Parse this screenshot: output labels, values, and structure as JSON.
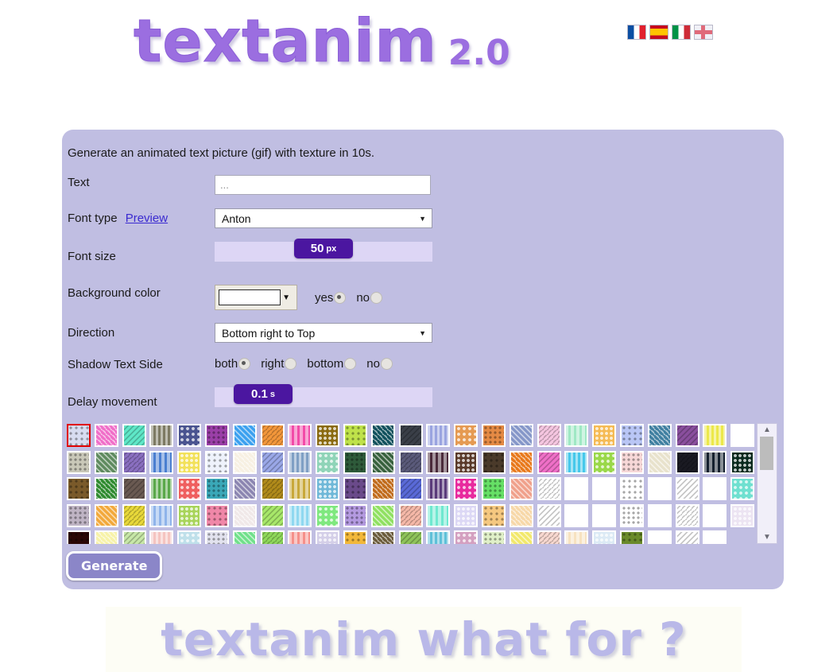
{
  "header": {
    "logo_word": "textanim",
    "logo_version": "2.0",
    "flags": [
      {
        "name": "flag-france",
        "label": "French"
      },
      {
        "name": "flag-spain",
        "label": "Spanish"
      },
      {
        "name": "flag-italy",
        "label": "Italian"
      },
      {
        "name": "flag-uk",
        "label": "English"
      }
    ]
  },
  "form": {
    "intro": "Generate an animated text picture (gif) with texture in 10s.",
    "text": {
      "label": "Text",
      "value": "",
      "placeholder": "..."
    },
    "font_type": {
      "label": "Font type",
      "preview_link": "Preview",
      "value": "Anton"
    },
    "font_size": {
      "label": "Font size",
      "value": "50",
      "unit": "px",
      "thumb_label": "50",
      "percent": 50
    },
    "background_color": {
      "label": "Background color",
      "swatch_color": "#ffffff",
      "options": [
        {
          "label": "yes",
          "selected": true
        },
        {
          "label": "no",
          "selected": false
        }
      ]
    },
    "direction": {
      "label": "Direction",
      "value": "Bottom right to Top"
    },
    "shadow_text_side": {
      "label": "Shadow Text Side",
      "options": [
        {
          "label": "both",
          "selected": true
        },
        {
          "label": "right",
          "selected": false
        },
        {
          "label": "bottom",
          "selected": false
        },
        {
          "label": "no",
          "selected": false
        }
      ]
    },
    "delay_movement": {
      "label": "Delay movement",
      "value": "0.1",
      "unit": "s",
      "thumb_label": "0.1",
      "percent": 12
    },
    "generate_button": "Generate"
  },
  "textures": {
    "selected_index": 0,
    "scrollbar": {
      "up": "▲",
      "down": "▼"
    },
    "swatches": [
      "#d8dcf0",
      "#f06ec8",
      "#5fe8c8",
      "#7d7a63",
      "#4a5490",
      "#9b3fa8",
      "#3aa0ef",
      "#f2963a",
      "#f24ba8",
      "#8a6a10",
      "#bfe24a",
      "#10505c",
      "#3a3f48",
      "#9aa4e0",
      "#e59a52",
      "#e58a44",
      "#8496c8",
      "#f5c6e0",
      "#9fe8c4",
      "#f5bb55",
      "#b9c6f5",
      "#3f7fa0",
      "#8a4f9e",
      "#ece84a",
      "#ffffff",
      "#c9c8b8",
      "#5e8a5e",
      "#8a6fc0",
      "#4a7fd0",
      "#f2e15a",
      "#eef2fb",
      "#f7f0e2",
      "#9aa8e8",
      "#7f9fc4",
      "#8fd4b8",
      "#2e5a3a",
      "#36603c",
      "#5a5a7a",
      "#4a2a3a",
      "#5a3a2a",
      "#4a3a2a",
      "#e8781a",
      "#f070c8",
      "#46c8ea",
      "#9ad84a",
      "#f7d8d8",
      "#e8e2cc",
      "#1a1a22",
      "#14202e",
      "#0a2a1e",
      "#7a5a2a",
      "#2e8a2e",
      "#6a5a52",
      "#5aa84a",
      "#ef5f5f",
      "#3aa8b8",
      "#8a84b0",
      "#b08a1a",
      "#c8a83a",
      "#6fb8d8",
      "#6a4a8a",
      "#c06a1a",
      "#5a6ad8",
      "#5a3a7a",
      "#e82a9e",
      "#66e066",
      "#f0a08a",
      "#ffffff",
      "#ffffff",
      "#ffffff",
      "#ffffff",
      "#ffffff",
      "#ffffff",
      "#ffffff",
      "#6fe0d0",
      "#bfb4c4",
      "#f2a83a",
      "#e8d83a",
      "#8fb4ea",
      "#a8d45a",
      "#f087a8",
      "#f0e8e8",
      "#a8e86a",
      "#8fd8f0",
      "#7fe87f",
      "#b49ae0",
      "#8fe060",
      "#f5b8a8",
      "#6fe8d0",
      "#dcd8f5",
      "#f5c880",
      "#f7d8a8",
      "#ffffff",
      "#ffffff",
      "#ffffff",
      "#ffffff",
      "#ffffff",
      "#ffffff",
      "#ffffff",
      "#ece4f2",
      "#2a0606",
      "#f7f2a8",
      "#c8e8a8",
      "#f5c4c0",
      "#bfe0ea",
      "#e2e2ee",
      "#6fe08a",
      "#8fd85a",
      "#f5908a",
      "#d4cfe8",
      "#f2b83a",
      "#6a5a3a",
      "#8fc45a",
      "#5fc0d8",
      "#d4a0c0",
      "#e0f0c8",
      "#f2e86a",
      "#f7d8d0",
      "#f7e2c0",
      "#dceaf5",
      "#6a8a2a",
      "#ffffff",
      "#ffffff",
      "#ffffff"
    ]
  },
  "footer": {
    "banner_text": "textanim what for ?"
  },
  "colors": {
    "panel": "#c0bee2",
    "accent": "#4b16a0",
    "slider_track": "#ddd6f5",
    "selection": "#e00000",
    "logo": "#9b6ee0"
  }
}
